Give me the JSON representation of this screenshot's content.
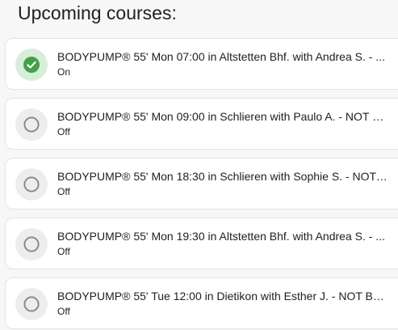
{
  "header": {
    "title": "Upcoming courses:"
  },
  "colors": {
    "on_accent": "#43a047",
    "off_ring": "#8a8a8a"
  },
  "courses": [
    {
      "title": "BODYPUMP® 55' Mon 07:00 in Altstetten Bhf. with Andrea S. - ...",
      "state": "On",
      "icon": "check-circle-icon"
    },
    {
      "title": "BODYPUMP® 55' Mon 09:00 in Schlieren with Paulo A. - NOT B...",
      "state": "Off",
      "icon": "empty-circle-icon"
    },
    {
      "title": "BODYPUMP® 55' Mon 18:30 in Schlieren with Sophie S. - NOT ...",
      "state": "Off",
      "icon": "empty-circle-icon"
    },
    {
      "title": "BODYPUMP® 55' Mon 19:30 in Altstetten Bhf. with Andrea S. - ...",
      "state": "Off",
      "icon": "empty-circle-icon"
    },
    {
      "title": "BODYPUMP® 55' Tue 12:00 in Dietikon with Esther J. - NOT BO...",
      "state": "Off",
      "icon": "empty-circle-icon"
    }
  ]
}
